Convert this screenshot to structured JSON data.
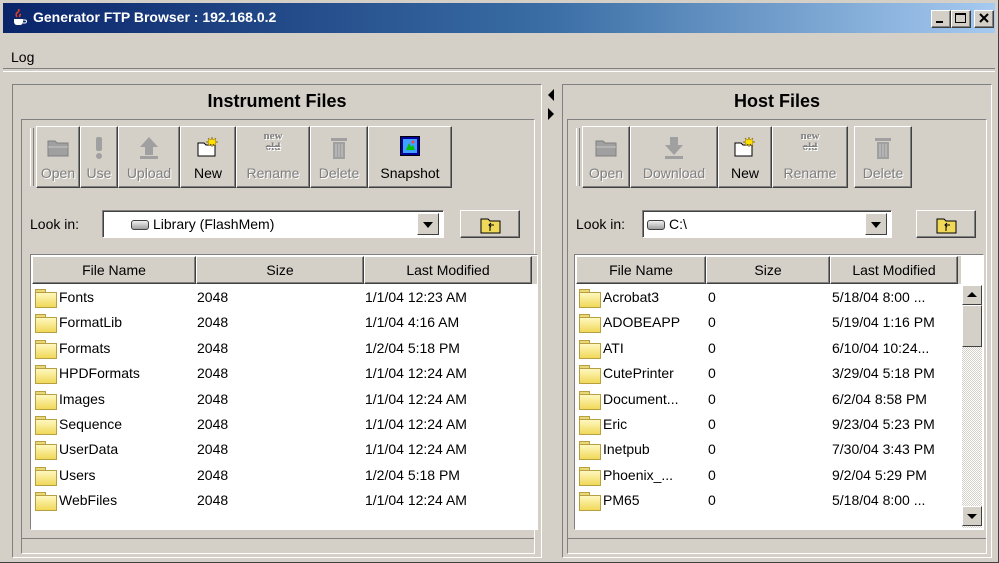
{
  "window": {
    "title": "Generator FTP Browser : 192.168.0.2",
    "app_icon": "java-cup-icon"
  },
  "menu": [
    "Log"
  ],
  "left": {
    "title": "Instrument Files",
    "toolbar": [
      {
        "label": "Open",
        "icon": "folder-open-icon",
        "enabled": false
      },
      {
        "label": "Use",
        "icon": "exclamation-icon",
        "enabled": false
      },
      {
        "label": "Upload",
        "icon": "upload-arrow-icon",
        "enabled": false
      },
      {
        "label": "New",
        "icon": "new-folder-icon",
        "enabled": true
      },
      {
        "label": "Rename",
        "icon": "rename-icon",
        "enabled": false,
        "top_text": [
          "new",
          "old"
        ]
      },
      {
        "label": "Delete",
        "icon": "trash-icon",
        "enabled": false
      },
      {
        "label": "Snapshot",
        "icon": "snapshot-icon",
        "enabled": true
      }
    ],
    "look_in_label": "Look in:",
    "look_in_value": "Library   (FlashMem)",
    "columns": [
      "File Name",
      "Size",
      "Last Modified"
    ],
    "rows": [
      {
        "name": "Fonts",
        "size": "2048",
        "modified": "1/1/04 12:23 AM"
      },
      {
        "name": "FormatLib",
        "size": "2048",
        "modified": "1/1/04 4:16 AM"
      },
      {
        "name": "Formats",
        "size": "2048",
        "modified": "1/2/04 5:18 PM"
      },
      {
        "name": "HPDFormats",
        "size": "2048",
        "modified": "1/1/04 12:24 AM"
      },
      {
        "name": "Images",
        "size": "2048",
        "modified": "1/1/04 12:24 AM"
      },
      {
        "name": "Sequence",
        "size": "2048",
        "modified": "1/1/04 12:24 AM"
      },
      {
        "name": "UserData",
        "size": "2048",
        "modified": "1/1/04 12:24 AM"
      },
      {
        "name": "Users",
        "size": "2048",
        "modified": "1/2/04 5:18 PM"
      },
      {
        "name": "WebFiles",
        "size": "2048",
        "modified": "1/1/04 12:24 AM"
      }
    ]
  },
  "right": {
    "title": "Host Files",
    "toolbar": [
      {
        "label": "Open",
        "icon": "folder-open-icon",
        "enabled": false
      },
      {
        "label": "Download",
        "icon": "download-arrow-icon",
        "enabled": false
      },
      {
        "label": "New",
        "icon": "new-folder-icon",
        "enabled": true
      },
      {
        "label": "Rename",
        "icon": "rename-icon",
        "enabled": false,
        "top_text": [
          "new",
          "old"
        ]
      },
      {
        "label": "Delete",
        "icon": "trash-icon",
        "enabled": false
      }
    ],
    "look_in_label": "Look in:",
    "look_in_value": "C:\\",
    "columns": [
      "File Name",
      "Size",
      "Last Modified"
    ],
    "rows": [
      {
        "name": "Acrobat3",
        "size": "0",
        "modified": "5/18/04 8:00 ..."
      },
      {
        "name": "ADOBEAPP",
        "size": "0",
        "modified": "5/19/04 1:16 PM"
      },
      {
        "name": "ATI",
        "size": "0",
        "modified": "6/10/04 10:24..."
      },
      {
        "name": "CutePrinter",
        "size": "0",
        "modified": "3/29/04 5:18 PM"
      },
      {
        "name": "Document...",
        "size": "0",
        "modified": "6/2/04 8:58 PM"
      },
      {
        "name": "Eric",
        "size": "0",
        "modified": "9/23/04 5:23 PM"
      },
      {
        "name": "Inetpub",
        "size": "0",
        "modified": "7/30/04 3:43 PM"
      },
      {
        "name": "Phoenix_...",
        "size": "0",
        "modified": "9/2/04 5:29 PM"
      },
      {
        "name": "PM65",
        "size": "0",
        "modified": "5/18/04 8:00 ..."
      }
    ]
  }
}
